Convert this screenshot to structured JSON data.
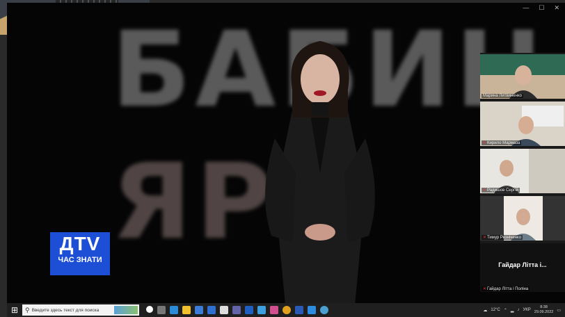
{
  "broadcast": {
    "background_word_line1": "БАБИН",
    "background_word_line2": "ЯР"
  },
  "logo": {
    "main": "ДTV",
    "sub": "ЧАС ЗНАТИ"
  },
  "participants": [
    {
      "name": "Марина Литвиненко"
    },
    {
      "name": "Кирило Мармаза"
    },
    {
      "name": "Радишов Сергій"
    },
    {
      "name": "Тимур Резніченко"
    },
    {
      "name": "Гайдар Літта і Поліна",
      "display_title": "Гайдар Літта і..."
    }
  ],
  "taskbar": {
    "search_placeholder": "Введите здесь текст для поиска",
    "temperature": "12°C",
    "language": "УКР",
    "time": "8:38",
    "date": "29.09.2022"
  },
  "colors": {
    "logo_bg": "#1d4fd6",
    "taskbar_bg": "#1f1f1f"
  }
}
